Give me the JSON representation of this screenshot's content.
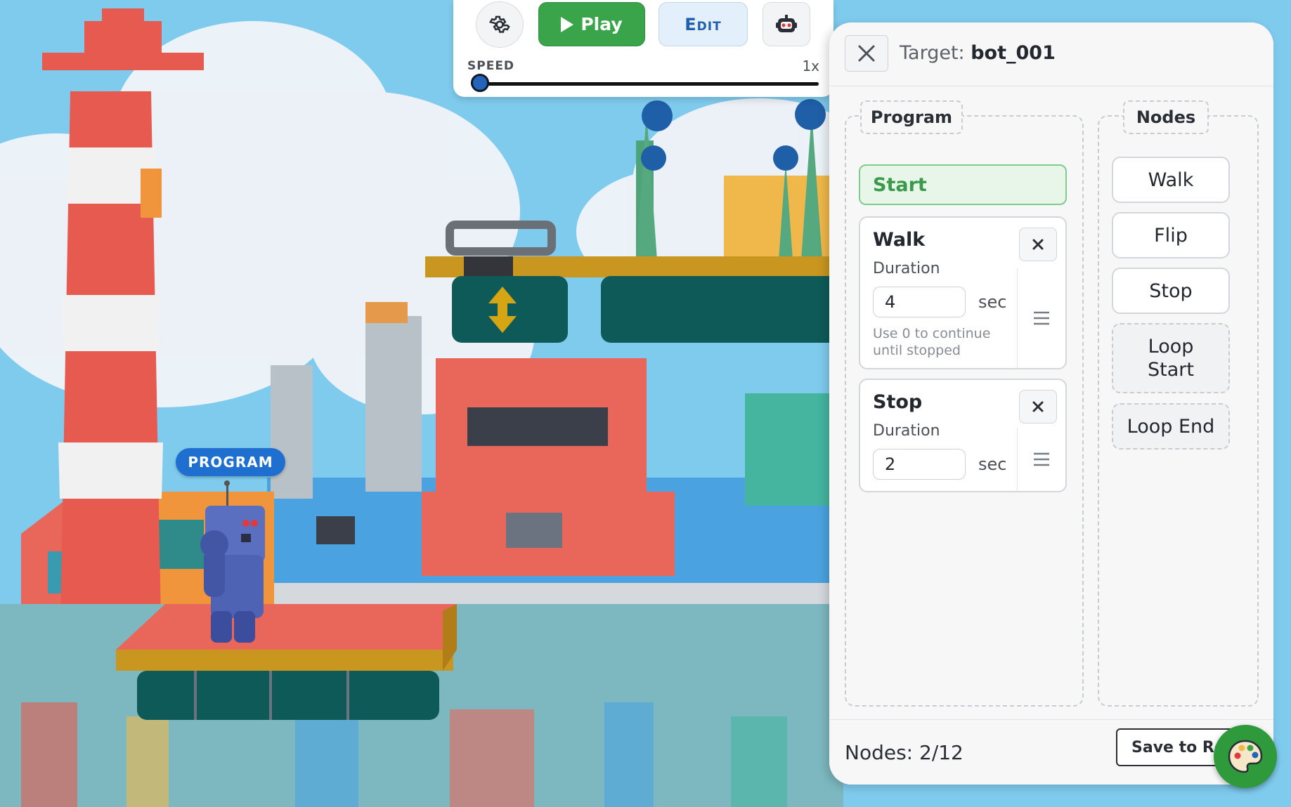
{
  "scene": {
    "program_tag": "PROGRAM"
  },
  "toolbar": {
    "settings_icon": "gear-icon",
    "play_label": "Play",
    "edit_label": "Edit",
    "robot_icon": "robot-head-icon",
    "speed_label": "SPEED",
    "speed_value": "1x",
    "speed_level": 0
  },
  "panel": {
    "target_prefix": "Target:",
    "target_id": "bot_001",
    "program_title": "Program",
    "nodes_title": "Nodes",
    "start_label": "Start",
    "program_nodes": [
      {
        "title": "Walk",
        "field_label": "Duration",
        "value": "4",
        "unit": "sec",
        "hint": "Use 0 to continue until stopped"
      },
      {
        "title": "Stop",
        "field_label": "Duration",
        "value": "2",
        "unit": "sec"
      }
    ],
    "palette": [
      {
        "label": "Walk"
      },
      {
        "label": "Flip"
      },
      {
        "label": "Stop"
      },
      {
        "label": "Loop Start"
      },
      {
        "label": "Loop End"
      }
    ],
    "node_count": "Nodes: 2/12",
    "save_label": "Save to Robot"
  },
  "colors": {
    "play": "#3aa44a",
    "edit_text": "#1f5fad",
    "program_tag": "#1f6fd0",
    "start_node": "#3a9a4c",
    "palette_fab": "#2f9a3c"
  }
}
